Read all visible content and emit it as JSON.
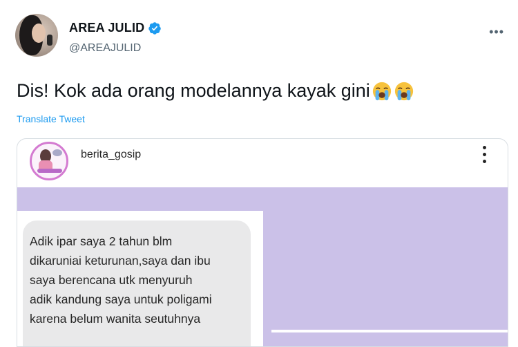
{
  "author": {
    "display_name": "AREA JULID",
    "handle": "@AREAJULID",
    "verified": true
  },
  "tweet": {
    "text": "Dis! Kok ada orang modelannya kayak gini",
    "emojis": [
      "loudly-crying-face",
      "loudly-crying-face"
    ],
    "translate_label": "Translate Tweet"
  },
  "more_menu_icon": "more-horizontal-icon",
  "embedded_post": {
    "username": "berita_gosip",
    "more_icon": "more-vertical-icon",
    "message_lines": [
      "Adik ipar saya 2 tahun blm",
      "dikaruniai keturunan,saya dan ibu",
      "saya berencana utk menyuruh",
      "adik kandung saya untuk poligami",
      "karena belum wanita seutuhnya"
    ]
  },
  "colors": {
    "link": "#1d9bf0",
    "verified": "#1d9bf0",
    "handle": "#536471",
    "purple_bg": "#cbc1e8",
    "bubble": "#e9e9ea"
  }
}
